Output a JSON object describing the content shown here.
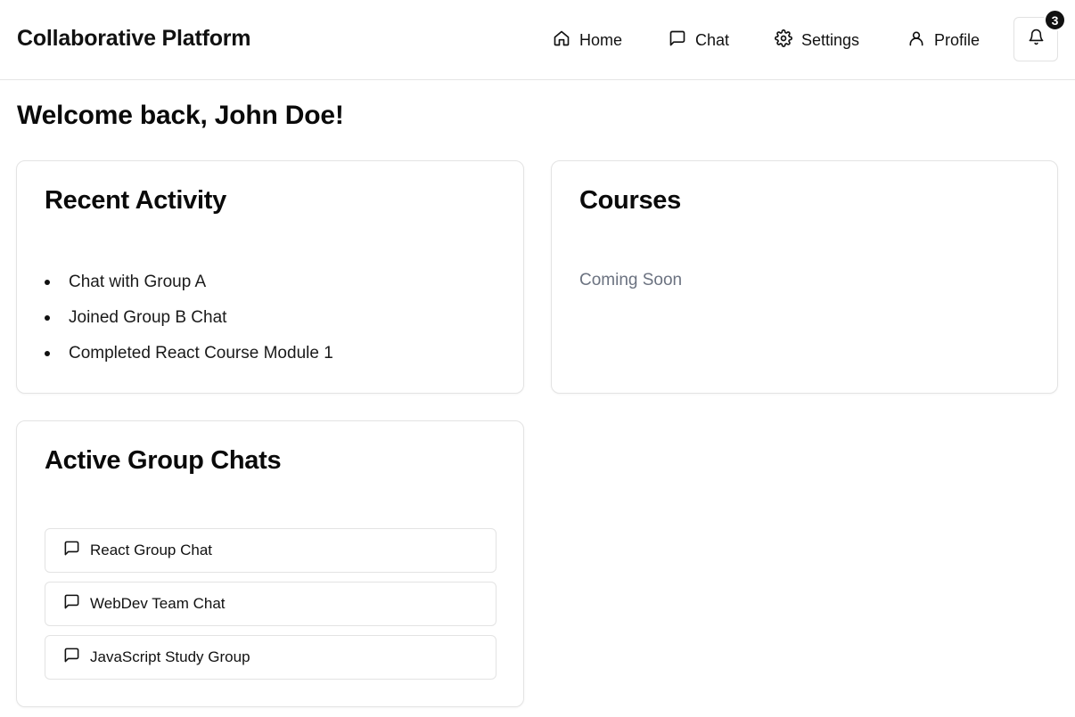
{
  "header": {
    "title": "Collaborative Platform",
    "nav": {
      "home": {
        "label": "Home",
        "icon": "home-icon"
      },
      "chat": {
        "label": "Chat",
        "icon": "message-square-icon"
      },
      "settings": {
        "label": "Settings",
        "icon": "gear-icon"
      },
      "profile": {
        "label": "Profile",
        "icon": "user-icon"
      }
    },
    "notifications": {
      "icon": "bell-icon",
      "count": "3"
    }
  },
  "welcome": {
    "text": "Welcome back, John Doe!"
  },
  "recent_activity": {
    "title": "Recent Activity",
    "items": [
      {
        "label": "Chat with Group A"
      },
      {
        "label": "Joined Group B Chat"
      },
      {
        "label": "Completed React Course Module 1"
      }
    ]
  },
  "courses": {
    "title": "Courses",
    "status": "Coming Soon"
  },
  "group_chats": {
    "title": "Active Group Chats",
    "items": [
      {
        "label": "React Group Chat",
        "icon": "message-square-icon"
      },
      {
        "label": "WebDev Team Chat",
        "icon": "message-square-icon"
      },
      {
        "label": "JavaScript Study Group",
        "icon": "message-square-icon"
      }
    ]
  },
  "colors": {
    "text": "#0a0a0a",
    "muted": "#6b7280",
    "border": "#e3e3e3",
    "badge": "#111111"
  }
}
